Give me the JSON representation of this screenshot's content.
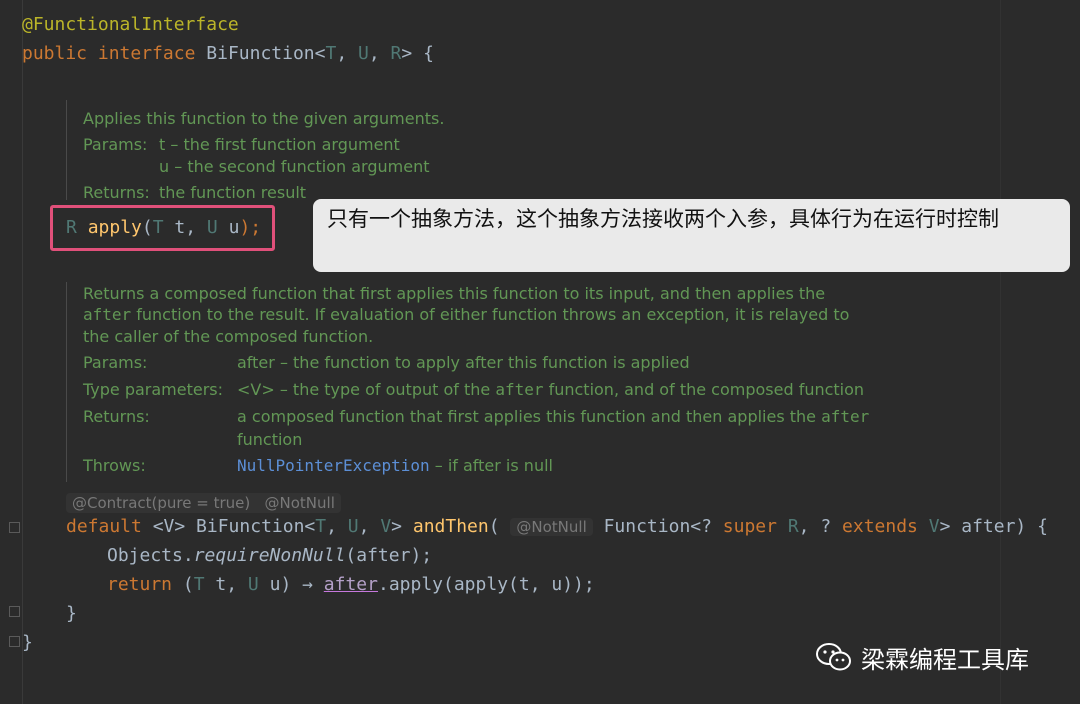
{
  "code": {
    "annotation": "@FunctionalInterface",
    "decl": {
      "kw1": "public",
      "kw2": "interface",
      "name": "BiFunction",
      "open": "<",
      "t": "T",
      ",1": ", ",
      "u": "U",
      ",2": ", ",
      "r": "R",
      "close": "> {"
    },
    "apply": {
      "r": "R ",
      "name": "apply",
      "open": "(",
      "t": "T",
      "tvar": " t, ",
      "u": "U",
      "uvar": " u",
      "close": ");"
    },
    "contract_hint": "@Contract(pure = true)",
    "notnull_hint": "@NotNull",
    "default_line": {
      "kw": "default",
      "tp": " <V> ",
      "type": "BiFunction<",
      "t": "T",
      ",1": ", ",
      "u": "U",
      ",2": ", ",
      "v": "V",
      "gt": "> ",
      "name": "andThen",
      "open": "( ",
      "param_hint": "@NotNull",
      "fn": " Function<? ",
      "super": "super",
      "r": " R",
      "comma": ", ? ",
      "extends": "extends",
      "v2": " V",
      "rest": "> after) {"
    },
    "req_line": {
      "obj": "Objects.",
      "method": "requireNonNull",
      "args": "(after);"
    },
    "return_line": {
      "kw": "return",
      "open": " (",
      "t": "T",
      "tvar": " t, ",
      "u": "U",
      "uvar": " u) → ",
      "after": "after",
      "rest": ".apply(apply(t, u));"
    },
    "close_inner": "}",
    "close_outer": "}"
  },
  "doc1": {
    "summary": "Applies this function to the given arguments.",
    "params_label": "Params:",
    "param_t": "t – the first function argument",
    "param_u": "u – the second function argument",
    "returns_label": "Returns:",
    "returns": "the function result"
  },
  "doc2": {
    "line1": "Returns a composed function that first applies this function to its input, and then applies the",
    "line2_code": "after",
    "line2_rest": " function to the result. If evaluation of either function throws an exception, it is relayed to",
    "line3": "the caller of the composed function.",
    "params_label": "Params:",
    "params": "after – the function to apply after this function is applied",
    "type_label": "Type parameters:",
    "type_pre": "<V> – the type of output of the ",
    "type_code": "after",
    "type_post": " function, and of the composed function",
    "returns_label": "Returns:",
    "returns_pre": "a composed function that first applies this function and then applies the ",
    "returns_code": "after",
    "returns_line2": "function",
    "throws_label": "Throws:",
    "throws_link": "NullPointerException",
    "throws_rest": " – if after is null"
  },
  "callout": {
    "text": "只有一个抽象方法，这个抽象方法接收两个入参，具体行为在运行时控制"
  },
  "watermark": {
    "text": "梁霖编程工具库",
    "icon": "wechat-icon"
  },
  "colors": {
    "background": "#2b2b2b",
    "keyword": "#cc7832",
    "annotation": "#bbb529",
    "doc": "#629755",
    "highlight": "#e0507a"
  }
}
